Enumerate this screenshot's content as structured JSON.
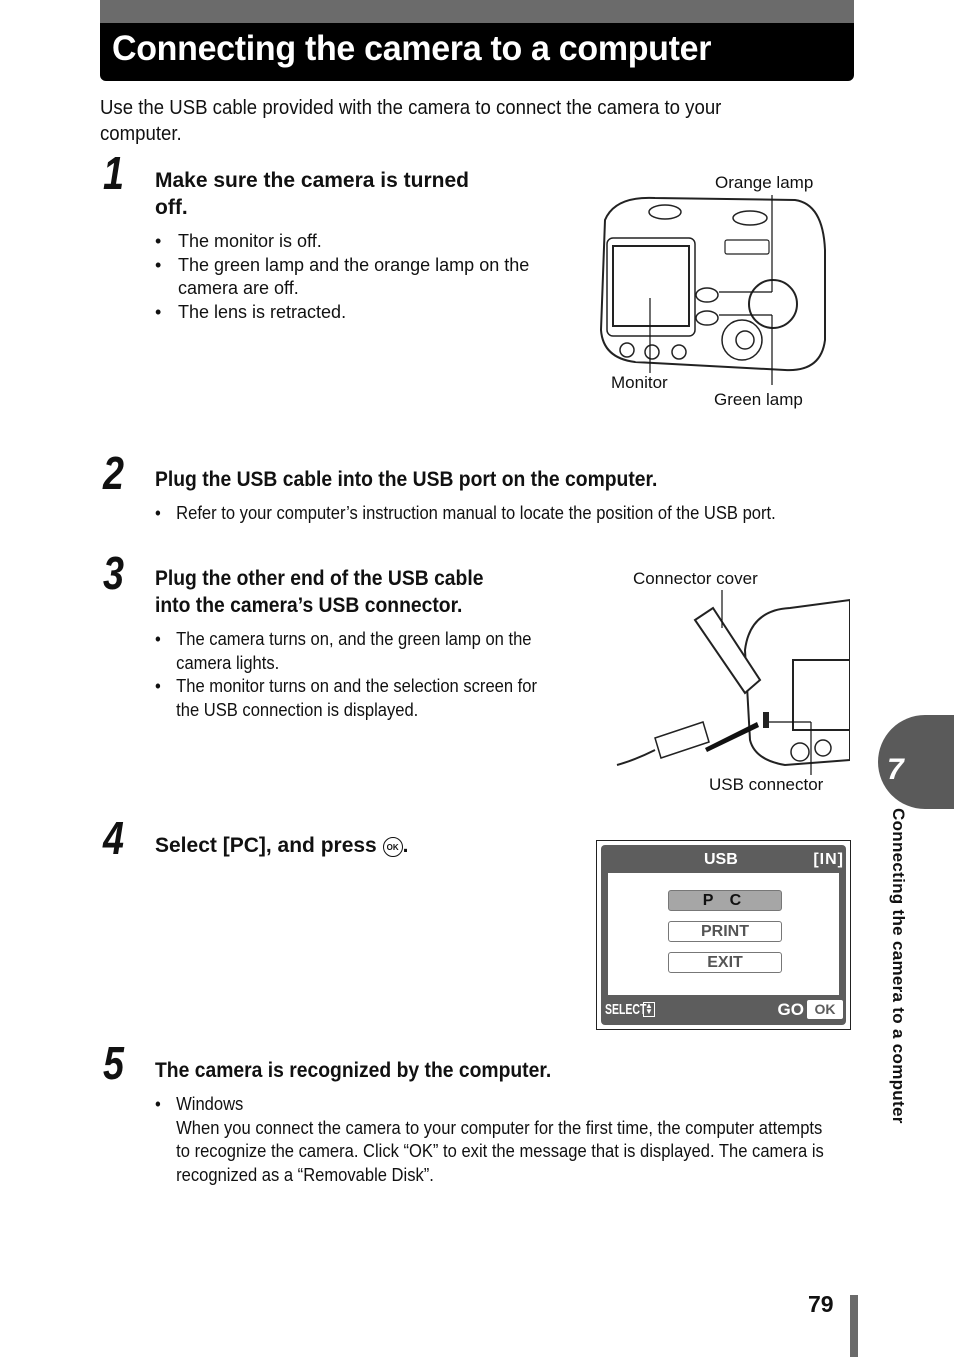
{
  "header": {
    "title": "Connecting the camera to a computer",
    "intro": "Use the USB cable provided with the camera to connect the camera to your computer."
  },
  "steps": [
    {
      "number": "1",
      "title_line1": "Make sure the camera is turned",
      "title_line2": "off.",
      "bullets": [
        "The monitor is off.",
        "The green lamp and the orange lamp on the camera are off.",
        "The lens is retracted."
      ]
    },
    {
      "number": "2",
      "title": "Plug the USB cable into the USB port on the computer.",
      "bullets": [
        "Refer to your computer’s instruction manual to locate the position of the USB port."
      ]
    },
    {
      "number": "3",
      "title_line1": "Plug the other end of the USB cable",
      "title_line2": "into the camera’s USB connector.",
      "bullets": [
        "The camera turns on, and the green lamp on the camera lights.",
        "The monitor turns on and the selection screen for the USB connection is displayed."
      ]
    },
    {
      "number": "4",
      "title_prefix": "Select [PC], and press",
      "ok_glyph": "OK",
      "title_suffix": "."
    },
    {
      "number": "5",
      "title": "The camera is recognized by the computer.",
      "bullet_heading": "Windows",
      "bullet_body": "When you connect the camera to your computer for the first time, the computer attempts to recognize the camera. Click “OK” to exit the message that is displayed. The camera is recognized as a “Removable Disk”."
    }
  ],
  "figure1": {
    "labels": {
      "orange_lamp": "Orange lamp",
      "monitor": "Monitor",
      "green_lamp": "Green lamp"
    }
  },
  "figure2": {
    "labels": {
      "connector_cover": "Connector cover",
      "usb_connector": "USB connector"
    }
  },
  "lcd_screen": {
    "title": "USB",
    "memory": "[IN]",
    "options": [
      {
        "label": "P C",
        "selected": true
      },
      {
        "label": "PRINT",
        "selected": false
      },
      {
        "label": "EXIT",
        "selected": false
      }
    ],
    "footer_left": "SELECT",
    "footer_go": "GO",
    "footer_ok": "OK"
  },
  "chapter_tab": {
    "number": "7",
    "title": "Connecting the camera to a computer"
  },
  "page_number": "79"
}
